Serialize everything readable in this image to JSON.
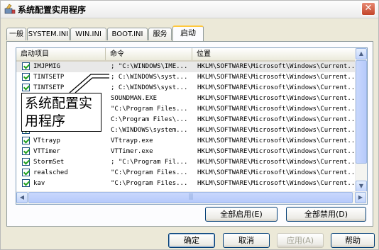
{
  "window": {
    "title": "系统配置实用程序",
    "close_symbol": "✕"
  },
  "tabs": [
    {
      "label": "一般"
    },
    {
      "label": "SYSTEM.INI"
    },
    {
      "label": "WIN.INI"
    },
    {
      "label": "BOOT.INI"
    },
    {
      "label": "服务"
    },
    {
      "label": "启动",
      "active": true
    }
  ],
  "listview": {
    "columns": [
      "启动项目",
      "命令",
      "位置"
    ],
    "rows": [
      {
        "item": "IMJPMIG",
        "command": "; \"C:\\WINDOWS\\IME...",
        "location": "HKLM\\SOFTWARE\\Microsoft\\Windows\\Current...",
        "checked": true,
        "selected": true
      },
      {
        "item": "TINTSETP",
        "command": "; C:\\WINDOWS\\syst...",
        "location": "HKLM\\SOFTWARE\\Microsoft\\Windows\\Current...",
        "checked": true
      },
      {
        "item": "TINTSETP",
        "command": "; C:\\WINDOWS\\syst...",
        "location": "HKLM\\SOFTWARE\\Microsoft\\Windows\\Current...",
        "checked": true
      },
      {
        "item": "",
        "command": "SOUNDMAN.EXE",
        "location": "HKLM\\SOFTWARE\\Microsoft\\Windows\\Current...",
        "checked": true
      },
      {
        "item": "",
        "command": "\"C:\\Program Files...",
        "location": "HKLM\\SOFTWARE\\Microsoft\\Windows\\Current...",
        "checked": true
      },
      {
        "item": "",
        "command": "C:\\Program Files\\...",
        "location": "HKLM\\SOFTWARE\\Microsoft\\Windows\\Current...",
        "checked": true
      },
      {
        "item": "",
        "command": "C:\\WINDOWS\\system...",
        "location": "HKLM\\SOFTWARE\\Microsoft\\Windows\\Current...",
        "checked": true
      },
      {
        "item": "VTtrayp",
        "command": "VTtrayp.exe",
        "location": "HKLM\\SOFTWARE\\Microsoft\\Windows\\Current...",
        "checked": true
      },
      {
        "item": "VTTimer",
        "command": "VTTimer.exe",
        "location": "HKLM\\SOFTWARE\\Microsoft\\Windows\\Current...",
        "checked": true
      },
      {
        "item": "StormSet",
        "command": "; \"C:\\Program Fil...",
        "location": "HKLM\\SOFTWARE\\Microsoft\\Windows\\Current...",
        "checked": true
      },
      {
        "item": "realsched",
        "command": "\"C:\\Program Files...",
        "location": "HKLM\\SOFTWARE\\Microsoft\\Windows\\Current...",
        "checked": true
      },
      {
        "item": "kav",
        "command": "\"C:\\Program Files...",
        "location": "HKLM\\SOFTWARE\\Microsoft\\Windows\\Current...",
        "checked": true
      }
    ]
  },
  "callout": {
    "text": "系统配置实\n用程序"
  },
  "scroll": {
    "up_icon": "▲",
    "down_icon": "▼",
    "left_icon": "◀",
    "right_icon": "▶",
    "grip": "|||"
  },
  "buttons": {
    "enable_all": "全部启用(E)",
    "disable_all": "全部禁用(D)",
    "ok": "确定",
    "cancel": "取消",
    "apply": "应用(A)",
    "help": "帮助"
  }
}
